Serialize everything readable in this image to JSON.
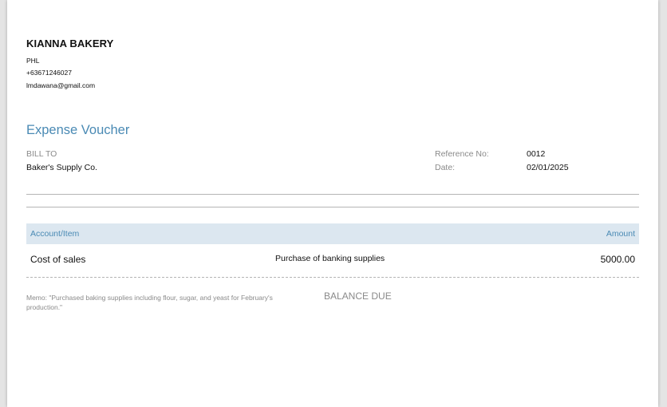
{
  "company": {
    "name": "KIANNA BAKERY",
    "country": "PHL",
    "phone": "+63671246027",
    "email": "lmdawana@gmail.com"
  },
  "document": {
    "title": "Expense Voucher",
    "bill_to_label": "BILL TO",
    "bill_to_value": "Baker's Supply Co.",
    "reference_label": "Reference No:",
    "reference_value": "0012",
    "date_label": "Date:",
    "date_value": "02/01/2025"
  },
  "table": {
    "headers": {
      "account": "Account/Item",
      "amount": "Amount"
    },
    "rows": [
      {
        "account": "Cost of sales",
        "description": "Purchase of banking supplies",
        "amount": "5000.00"
      }
    ]
  },
  "footer": {
    "memo": "Memo: \"Purchased baking supplies including flour, sugar, and yeast for February's production.\"",
    "balance_due_label": "BALANCE DUE"
  },
  "colors": {
    "accent": "#4a8ab4",
    "header_fill": "#dce7f0",
    "muted_text": "#8a8a8a"
  }
}
